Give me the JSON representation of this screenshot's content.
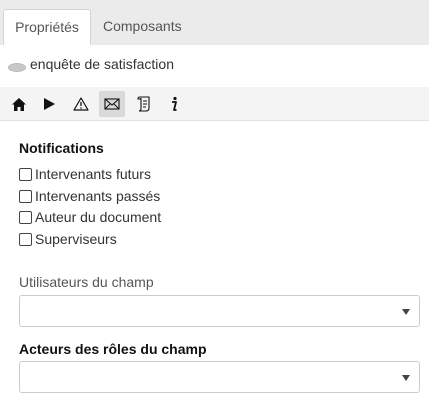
{
  "tabs": [
    {
      "label": "Propriétés",
      "active": true
    },
    {
      "label": "Composants",
      "active": false
    }
  ],
  "document": {
    "title": "enquête de satisfaction"
  },
  "toolbar": {
    "buttons": [
      {
        "icon": "home-icon"
      },
      {
        "icon": "play-icon"
      },
      {
        "icon": "warning-icon"
      },
      {
        "icon": "envelope-icon",
        "selected": true
      },
      {
        "icon": "script-icon"
      },
      {
        "icon": "info-icon"
      }
    ]
  },
  "notifications": {
    "heading": "Notifications",
    "options": [
      {
        "label": "Intervenants futurs",
        "checked": false
      },
      {
        "label": "Intervenants passés",
        "checked": false
      },
      {
        "label": "Auteur du document",
        "checked": false
      },
      {
        "label": "Superviseurs",
        "checked": false
      }
    ]
  },
  "field_users": {
    "label": "Utilisateurs du champ",
    "value": ""
  },
  "field_roles": {
    "label": "Acteurs des rôles du champ",
    "value": ""
  }
}
